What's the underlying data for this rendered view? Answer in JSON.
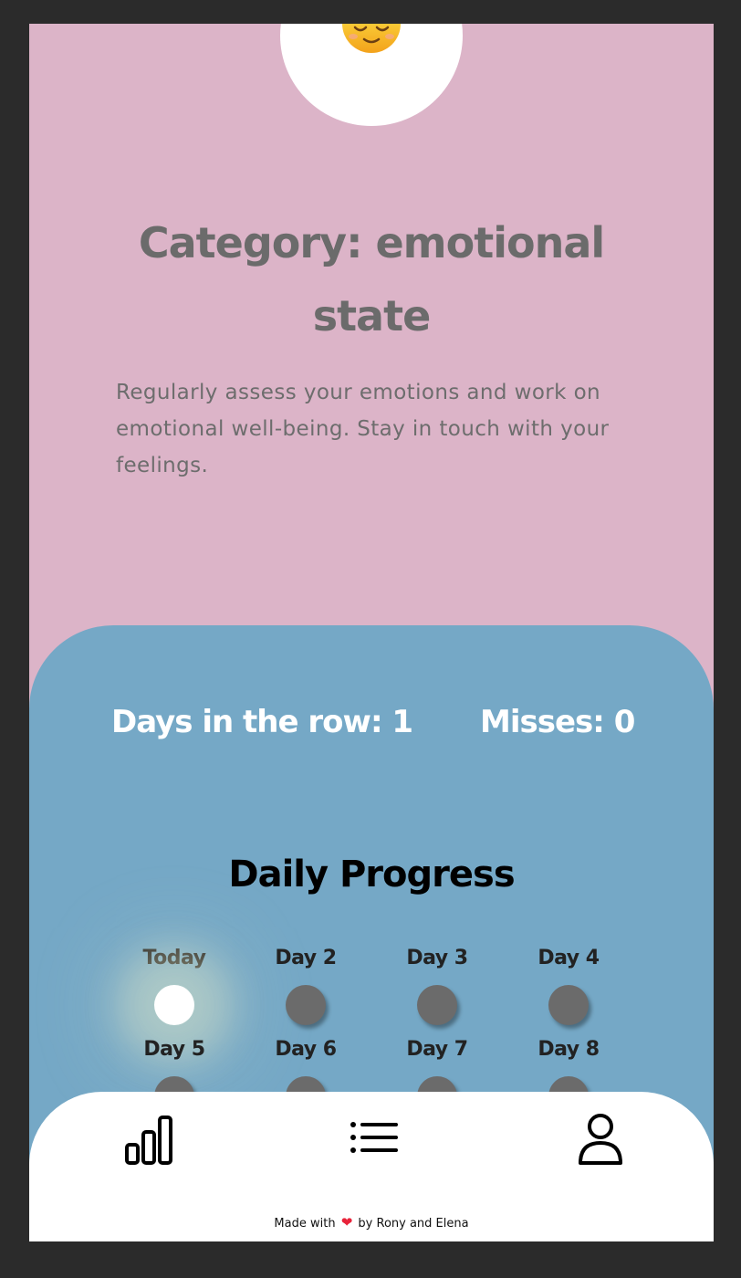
{
  "header": {
    "title": "Category: emotional state",
    "description": "Regularly assess your emotions and work on emotional well-being. Stay in touch with your feelings."
  },
  "stats": {
    "days_in_row": "Days in the row: 1",
    "misses": "Misses: 0"
  },
  "progress": {
    "title": "Daily Progress",
    "days": [
      {
        "label": "Today",
        "completed": true
      },
      {
        "label": "Day 2",
        "completed": false
      },
      {
        "label": "Day 3",
        "completed": false
      },
      {
        "label": "Day 4",
        "completed": false
      },
      {
        "label": "Day 5",
        "completed": false
      },
      {
        "label": "Day 6",
        "completed": false
      },
      {
        "label": "Day 7",
        "completed": false
      },
      {
        "label": "Day 8",
        "completed": false
      }
    ]
  },
  "nav": {
    "icons": [
      "bar-chart-icon",
      "list-icon",
      "profile-icon"
    ]
  },
  "footer": {
    "prefix": "Made with",
    "heart": "❤",
    "suffix": "by Rony and Elena"
  },
  "colors": {
    "page_background": "#dcb4c8",
    "stats_panel": "#75a8c6",
    "nav_background": "#ffffff",
    "title_text": "#6b6b6b",
    "inactive_dot": "#6b6b6b",
    "active_dot": "#ffffff"
  }
}
